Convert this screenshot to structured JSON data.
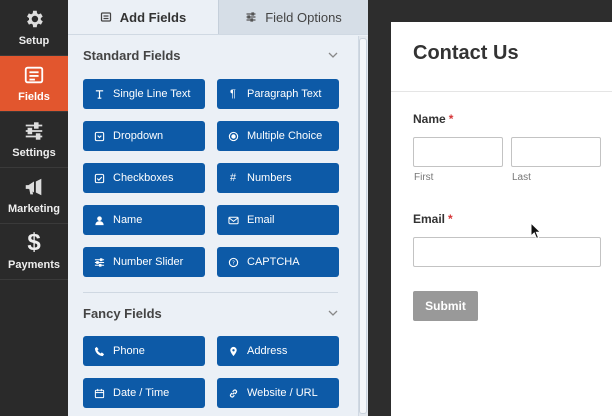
{
  "nav": {
    "items": [
      {
        "label": "Setup",
        "icon": "gear-icon"
      },
      {
        "label": "Fields",
        "icon": "fields-list-icon"
      },
      {
        "label": "Settings",
        "icon": "sliders-icon"
      },
      {
        "label": "Marketing",
        "icon": "megaphone-icon"
      },
      {
        "label": "Payments",
        "icon": "dollar-icon"
      }
    ],
    "active": "Fields",
    "accent": "#e2562e"
  },
  "tabs": {
    "add_fields": "Add Fields",
    "field_options": "Field Options"
  },
  "sections": {
    "standard": {
      "title": "Standard Fields",
      "fields": [
        {
          "label": "Single Line Text",
          "icon": "text-icon"
        },
        {
          "label": "Paragraph Text",
          "icon": "paragraph-icon"
        },
        {
          "label": "Dropdown",
          "icon": "dropdown-icon"
        },
        {
          "label": "Multiple Choice",
          "icon": "radio-icon"
        },
        {
          "label": "Checkboxes",
          "icon": "checkbox-icon"
        },
        {
          "label": "Numbers",
          "icon": "hash-icon"
        },
        {
          "label": "Name",
          "icon": "user-icon"
        },
        {
          "label": "Email",
          "icon": "envelope-icon"
        },
        {
          "label": "Number Slider",
          "icon": "sliders-icon"
        },
        {
          "label": "CAPTCHA",
          "icon": "captcha-icon"
        }
      ]
    },
    "fancy": {
      "title": "Fancy Fields",
      "fields": [
        {
          "label": "Phone",
          "icon": "phone-icon"
        },
        {
          "label": "Address",
          "icon": "map-pin-icon"
        },
        {
          "label": "Date / Time",
          "icon": "calendar-icon"
        },
        {
          "label": "Website / URL",
          "icon": "link-icon"
        }
      ]
    }
  },
  "form": {
    "title": "Contact Us",
    "name_label": "Name",
    "required_mark": "*",
    "first_label": "First",
    "last_label": "Last",
    "email_label": "Email",
    "submit_label": "Submit"
  },
  "colors": {
    "button_blue": "#0d5aa7",
    "submit_gray": "#999999",
    "required_red": "#d63638"
  }
}
